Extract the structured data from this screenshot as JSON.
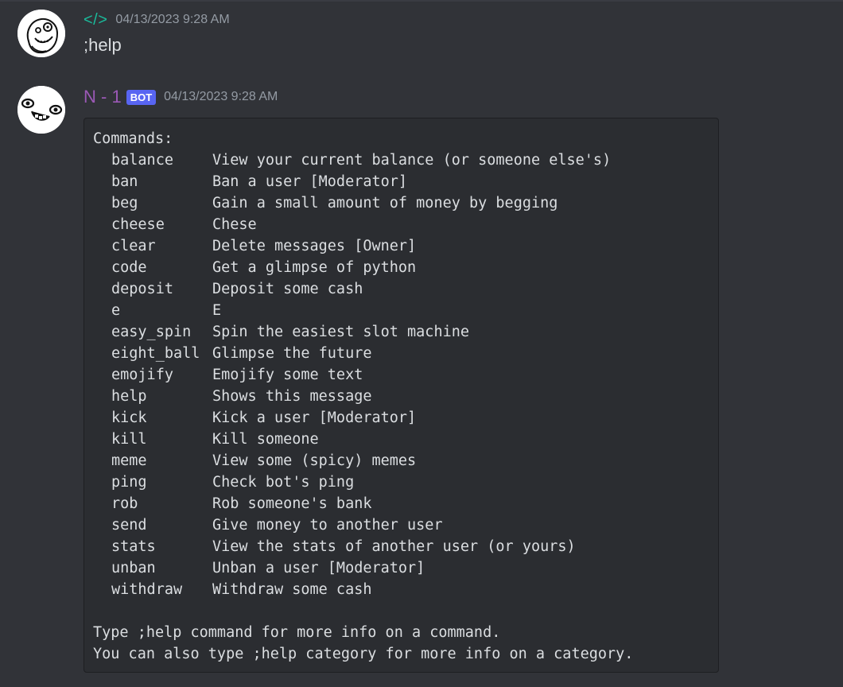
{
  "messages": [
    {
      "author": "</>",
      "timestamp": "04/13/2023 9:28 AM",
      "content": ";help"
    },
    {
      "author": "N - 1",
      "bot_tag": "BOT",
      "timestamp": "04/13/2023 9:28 AM",
      "code": {
        "heading": "Commands:",
        "commands": [
          {
            "name": "balance",
            "desc": "View your current balance (or someone else's)"
          },
          {
            "name": "ban",
            "desc": "Ban a user [Moderator]"
          },
          {
            "name": "beg",
            "desc": "Gain a small amount of money by begging"
          },
          {
            "name": "cheese",
            "desc": "Chese"
          },
          {
            "name": "clear",
            "desc": "Delete messages [Owner]"
          },
          {
            "name": "code",
            "desc": "Get a glimpse of python"
          },
          {
            "name": "deposit",
            "desc": "Deposit some cash"
          },
          {
            "name": "e",
            "desc": "E"
          },
          {
            "name": "easy_spin",
            "desc": "Spin the easiest slot machine"
          },
          {
            "name": "eight_ball",
            "desc": "Glimpse the future"
          },
          {
            "name": "emojify",
            "desc": "Emojify some text"
          },
          {
            "name": "help",
            "desc": "Shows this message"
          },
          {
            "name": "kick",
            "desc": "Kick a user [Moderator]"
          },
          {
            "name": "kill",
            "desc": "Kill someone"
          },
          {
            "name": "meme",
            "desc": "View some (spicy) memes"
          },
          {
            "name": "ping",
            "desc": "Check bot's ping"
          },
          {
            "name": "rob",
            "desc": "Rob someone's bank"
          },
          {
            "name": "send",
            "desc": "Give money to another user"
          },
          {
            "name": "stats",
            "desc": "View the stats of another user (or yours)"
          },
          {
            "name": "unban",
            "desc": "Unban a user [Moderator]"
          },
          {
            "name": "withdraw",
            "desc": "Withdraw some cash"
          }
        ],
        "footer_1": "Type ;help command for more info on a command.",
        "footer_2": "You can also type ;help category for more info on a category."
      }
    }
  ],
  "colors": {
    "background": "#313338",
    "codeblock_bg": "#2b2d31",
    "user_name_color": "#1abc9c",
    "bot_name_color": "#9b59b6",
    "bot_tag_bg": "#5865f2",
    "timestamp_color": "#949ba4",
    "text_color": "#dbdee1"
  },
  "icons": {
    "user_avatar": "troll-face-avatar-icon",
    "bot_avatar": "goofy-face-avatar-icon"
  }
}
